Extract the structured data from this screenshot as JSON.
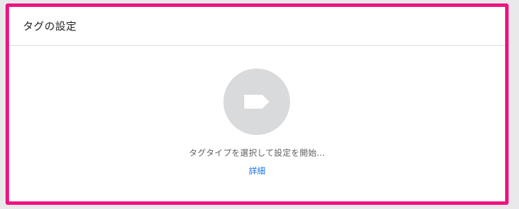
{
  "panel": {
    "title": "タグの設定"
  },
  "empty_state": {
    "icon": "tag-icon",
    "prompt": "タグタイプを選択して設定を開始...",
    "learn_more": "詳細"
  },
  "colors": {
    "highlight_border": "#f0127f",
    "icon_circle": "#d8dadc",
    "link": "#1a73e8"
  }
}
